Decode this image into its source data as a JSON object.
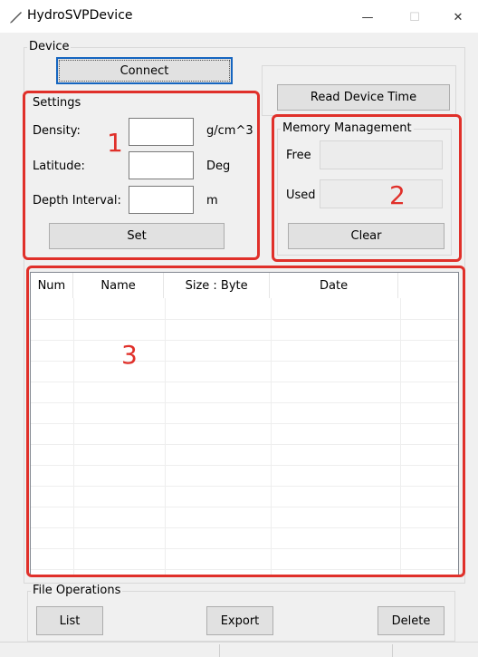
{
  "window": {
    "title": "HydroSVPDevice",
    "icon": "pen-icon",
    "minimize_glyph": "—",
    "maximize_glyph": "☐",
    "close_glyph": "✕"
  },
  "device": {
    "group_label": "Device",
    "connect_label": "Connect",
    "read_time_label": "Read  Device Time"
  },
  "settings": {
    "group_label": "Settings",
    "density_label": "Density:",
    "density_value": "",
    "density_unit": "g/cm^3",
    "latitude_label": "Latitude:",
    "latitude_value": "",
    "latitude_unit": "Deg",
    "depth_label": "Depth Interval:",
    "depth_value": "",
    "depth_unit": "m",
    "set_label": "Set"
  },
  "memory": {
    "group_label": "Memory Management",
    "free_label": "Free",
    "free_value": "",
    "used_label": "Used",
    "used_value": "",
    "clear_label": "Clear"
  },
  "file_list": {
    "columns": [
      "Num",
      "Name",
      "Size : Byte",
      "Date",
      ""
    ],
    "rows": []
  },
  "file_operations": {
    "group_label": "File Operations",
    "list_label": "List",
    "export_label": "Export",
    "delete_label": "Delete"
  },
  "annotations": {
    "color": "#e0302a",
    "region_1": "1",
    "region_2": "2",
    "region_3": "3"
  }
}
